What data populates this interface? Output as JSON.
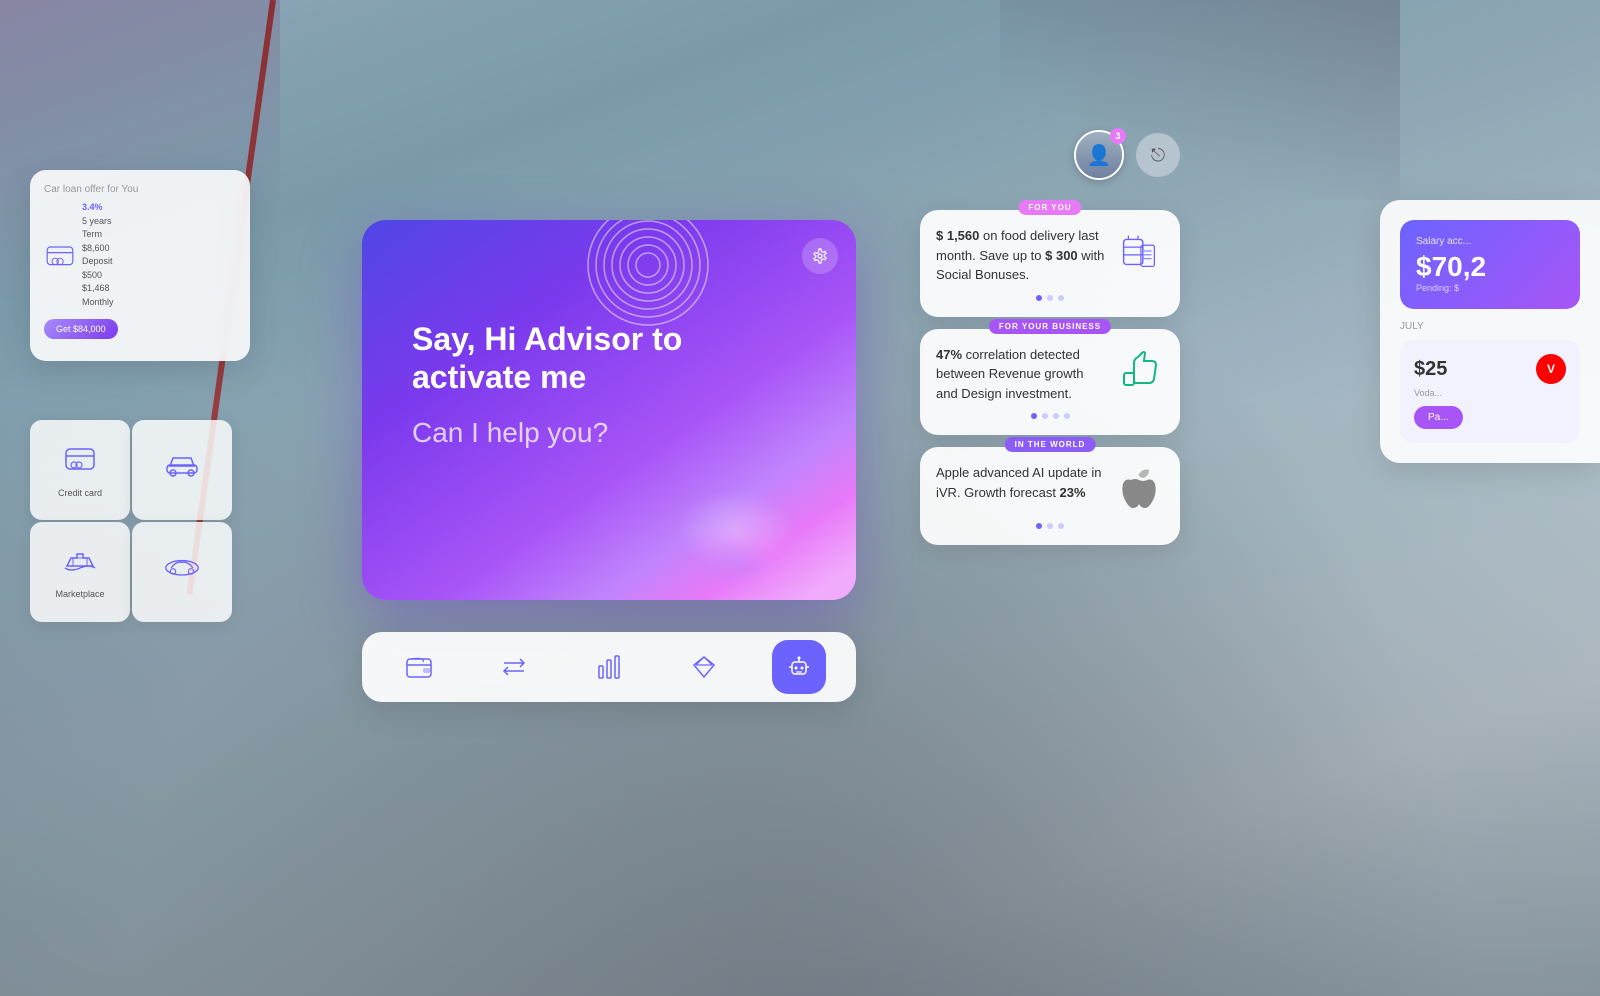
{
  "background": {
    "color": "#b0bec5"
  },
  "top_right": {
    "notification_count": "3",
    "logout_icon": "→"
  },
  "advisor_panel": {
    "title": "Say, Hi Advisor to activate me",
    "subtitle": "Can I help you?",
    "settings_icon": "⚙"
  },
  "toolbar": {
    "buttons": [
      {
        "label": "wallet",
        "icon": "💳",
        "active": false
      },
      {
        "label": "transfer",
        "icon": "⇄",
        "active": false
      },
      {
        "label": "analytics",
        "icon": "📊",
        "active": false
      },
      {
        "label": "rewards",
        "icon": "💎",
        "active": false
      },
      {
        "label": "advisor",
        "icon": "🤖",
        "active": true
      }
    ]
  },
  "left_panel": {
    "car_loan_title": "Car loan offer for You",
    "rate": "3.4%",
    "years": "5 years",
    "term": "Term",
    "amount": "$8,600",
    "deposit_label": "Deposit",
    "deposit_amount": "$500",
    "monthly": "$1,468",
    "monthly_label": "Monthly",
    "cta_label": "Get $84,000"
  },
  "grid_cards": [
    {
      "label": "Credit card",
      "icon": "💳"
    },
    {
      "label": "",
      "icon": "🚗"
    },
    {
      "label": "Marketplace",
      "icon": "🛒"
    },
    {
      "label": "",
      "icon": "🚢"
    }
  ],
  "info_cards": [
    {
      "badge": "FOR YOU",
      "badge_class": "foryou",
      "text_parts": {
        "prefix": "$ 1,560",
        "body": " on food delivery last month. Save up to ",
        "highlight": "$ 300",
        "suffix": " with Social Bonuses."
      },
      "dots": [
        true,
        false,
        false
      ],
      "icon": "food"
    },
    {
      "badge": "FOR YOUR BUSINESS",
      "badge_class": "business",
      "text_parts": {
        "prefix": "47%",
        "body": " correlation detected between Revenue growth and Design investment."
      },
      "dots": [
        true,
        false,
        false,
        false
      ],
      "icon": "thumbs"
    },
    {
      "badge": "IN THE WORLD",
      "badge_class": "world",
      "text_parts": {
        "body": "Apple advanced AI update in iVR. Growth forecast ",
        "suffix": "23%"
      },
      "dots": [
        true,
        false,
        false
      ],
      "icon": "apple"
    }
  ],
  "salary_card": {
    "title": "Salary acc...",
    "amount": "$70,2",
    "pending_label": "Pending: $",
    "month": "JULY",
    "amount2": "$25",
    "company": "Voda...",
    "pay_label": "Pa..."
  }
}
